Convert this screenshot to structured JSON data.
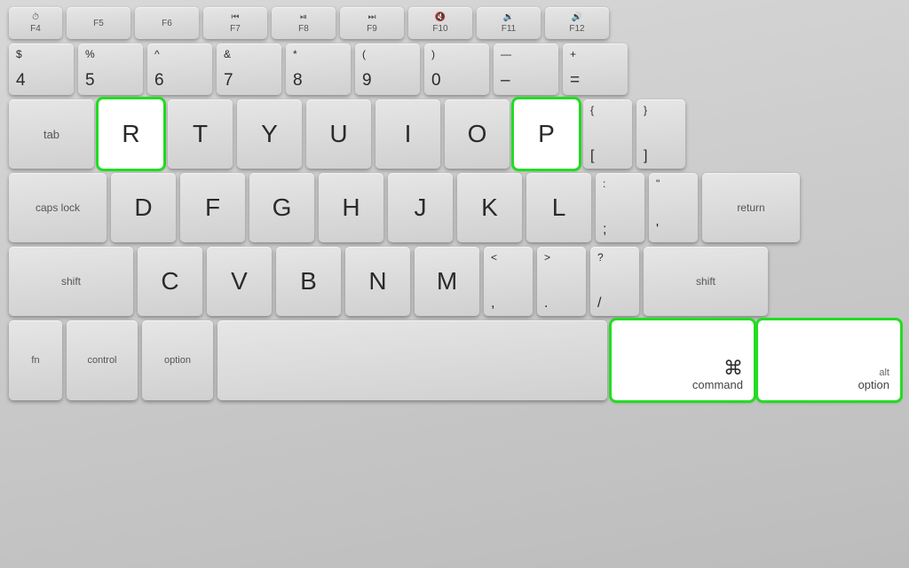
{
  "keyboard": {
    "background": "#c8c8c8",
    "rows": {
      "fn": {
        "keys": [
          {
            "id": "f4",
            "icon": "⏱",
            "label": "F4",
            "highlighted": false
          },
          {
            "id": "f5",
            "icon": "",
            "label": "F5",
            "highlighted": false
          },
          {
            "id": "f6",
            "icon": "",
            "label": "F6",
            "highlighted": false
          },
          {
            "id": "f7",
            "icon": "⏮",
            "label": "F7",
            "highlighted": false
          },
          {
            "id": "f8",
            "icon": "⏯",
            "label": "F8",
            "highlighted": false
          },
          {
            "id": "f9",
            "icon": "⏭",
            "label": "F9",
            "highlighted": false
          },
          {
            "id": "f10",
            "icon": "🔇",
            "label": "F10",
            "highlighted": false
          },
          {
            "id": "f11",
            "icon": "🔉",
            "label": "F11",
            "highlighted": false
          },
          {
            "id": "f12",
            "icon": "🔊",
            "label": "F12",
            "highlighted": false
          }
        ]
      },
      "number": {
        "keys": [
          {
            "id": "4",
            "top": "$",
            "bot": "4"
          },
          {
            "id": "5",
            "top": "%",
            "bot": "5"
          },
          {
            "id": "6",
            "top": "^",
            "bot": "6"
          },
          {
            "id": "7",
            "top": "&",
            "bot": "7"
          },
          {
            "id": "8",
            "top": "*",
            "bot": "8"
          },
          {
            "id": "9",
            "top": "(",
            "bot": "9"
          },
          {
            "id": "0",
            "top": ")",
            "bot": "0"
          },
          {
            "id": "minus",
            "top": "—",
            "bot": "–"
          },
          {
            "id": "equals",
            "top": "+",
            "bot": "="
          }
        ]
      },
      "qwerty": {
        "keys": [
          {
            "id": "R",
            "label": "R",
            "highlighted": true
          },
          {
            "id": "T",
            "label": "T",
            "highlighted": false
          },
          {
            "id": "Y",
            "label": "Y",
            "highlighted": false
          },
          {
            "id": "U",
            "label": "U",
            "highlighted": false
          },
          {
            "id": "I",
            "label": "I",
            "highlighted": false
          },
          {
            "id": "O",
            "label": "O",
            "highlighted": false
          },
          {
            "id": "P",
            "label": "P",
            "highlighted": true
          },
          {
            "id": "lbracket",
            "top": "{",
            "bot": "["
          },
          {
            "id": "rbracket",
            "top": "}",
            "bot": "]"
          }
        ]
      },
      "asdf": {
        "keys": [
          {
            "id": "D",
            "label": "D",
            "highlighted": false
          },
          {
            "id": "F",
            "label": "F",
            "highlighted": false
          },
          {
            "id": "G",
            "label": "G",
            "highlighted": false
          },
          {
            "id": "H",
            "label": "H",
            "highlighted": false
          },
          {
            "id": "J",
            "label": "J",
            "highlighted": false
          },
          {
            "id": "K",
            "label": "K",
            "highlighted": false
          },
          {
            "id": "L",
            "label": "L",
            "highlighted": false
          },
          {
            "id": "semicolon",
            "top": ":",
            "bot": ";"
          },
          {
            "id": "quote",
            "top": "\"",
            "bot": "'"
          }
        ]
      },
      "zxcv": {
        "keys": [
          {
            "id": "C",
            "label": "C",
            "highlighted": false
          },
          {
            "id": "V",
            "label": "V",
            "highlighted": false
          },
          {
            "id": "B",
            "label": "B",
            "highlighted": false
          },
          {
            "id": "N",
            "label": "N",
            "highlighted": false
          },
          {
            "id": "M",
            "label": "M",
            "highlighted": false
          },
          {
            "id": "comma",
            "top": "<",
            "bot": ","
          },
          {
            "id": "period",
            "top": ">",
            "bot": "."
          },
          {
            "id": "slash",
            "top": "?",
            "bot": "/"
          }
        ]
      },
      "bottom": {
        "fn_label": "fn",
        "ctrl_label": "control",
        "space_label": "",
        "cmd_symbol": "⌘",
        "cmd_label": "command",
        "opt_alt": "alt",
        "opt_label": "option"
      }
    }
  }
}
